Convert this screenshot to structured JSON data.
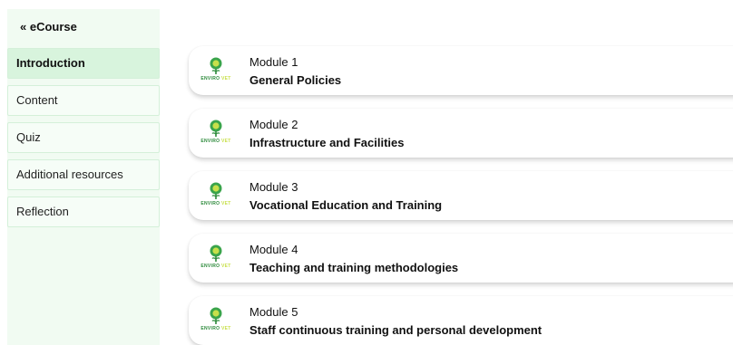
{
  "sidebar": {
    "back_label": "« eCourse",
    "items": [
      {
        "label": "Introduction",
        "active": true
      },
      {
        "label": "Content",
        "active": false
      },
      {
        "label": "Quiz",
        "active": false
      },
      {
        "label": "Additional resources",
        "active": false
      },
      {
        "label": "Reflection",
        "active": false
      }
    ]
  },
  "logo": {
    "enviro": "ENVIRO",
    "vet": "VET",
    "icon": "enviro-vet-logo-icon"
  },
  "modules": [
    {
      "number": "Module 1",
      "title": "General Policies"
    },
    {
      "number": "Module 2",
      "title": "Infrastructure and Facilities"
    },
    {
      "number": "Module 3",
      "title": "Vocational Education and Training"
    },
    {
      "number": "Module 4",
      "title": "Teaching and training methodologies"
    },
    {
      "number": "Module 5",
      "title": "Staff continuous training and personal development"
    }
  ],
  "colors": {
    "sidebar_bg": "#f1fbf2",
    "active_item_bg": "#d8f4dd",
    "logo_green": "#2e8b3c",
    "logo_lime": "#c8e04b"
  }
}
